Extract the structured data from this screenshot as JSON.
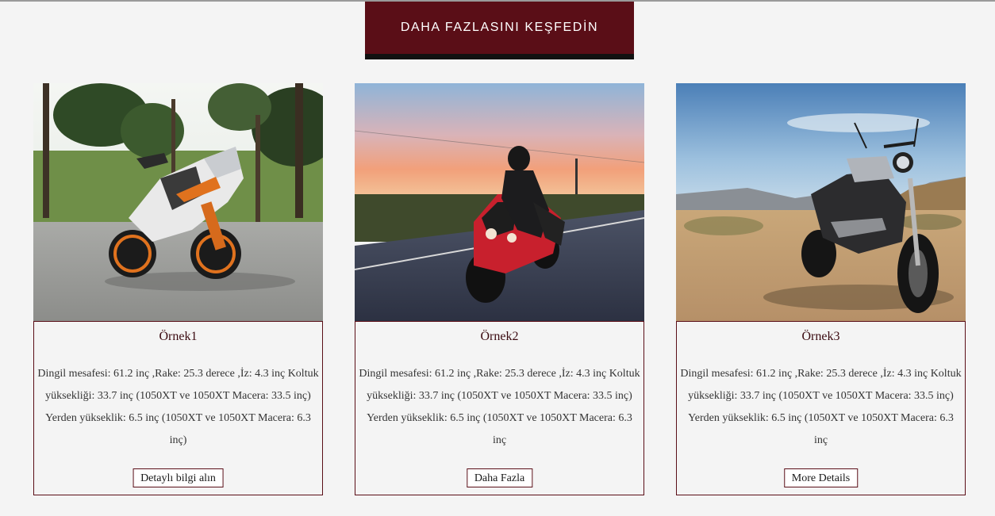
{
  "header": {
    "explore_label": "DAHA FAZLASINI KEŞFEDİN"
  },
  "cards": [
    {
      "title": "Örnek1",
      "description": "Dingil mesafesi: 61.2 inç ,Rake: 25.3 derece ,İz: 4.3 inç Koltuk yüksekliği: 33.7 inç (1050XT ve 1050XT Macera: 33.5 inç) Yerden yükseklik: 6.5 inç (1050XT ve 1050XT Macera: 6.3 inç)",
      "button_label": "Detaylı bilgi alın",
      "image_icon": "sport-motorcycle-photo"
    },
    {
      "title": "Örnek2",
      "description": "Dingil mesafesi: 61.2 inç ,Rake: 25.3 derece ,İz: 4.3 inç Koltuk yüksekliği: 33.7 inç (1050XT ve 1050XT Macera: 33.5 inç) Yerden yükseklik: 6.5 inç (1050XT ve 1050XT Macera: 6.3 inç",
      "button_label": "Daha Fazla",
      "image_icon": "rider-sunset-photo"
    },
    {
      "title": "Örnek3",
      "description": "Dingil mesafesi: 61.2 inç ,Rake: 25.3 derece ,İz: 4.3 inç Koltuk yüksekliği: 33.7 inç (1050XT ve 1050XT Macera: 33.5 inç) Yerden yükseklik: 6.5 inç (1050XT ve 1050XT Macera: 6.3 inç",
      "button_label": "More Details",
      "image_icon": "naked-motorcycle-desert-photo"
    }
  ],
  "colors": {
    "accent": "#5a0e17",
    "background": "#f4f4f4"
  }
}
